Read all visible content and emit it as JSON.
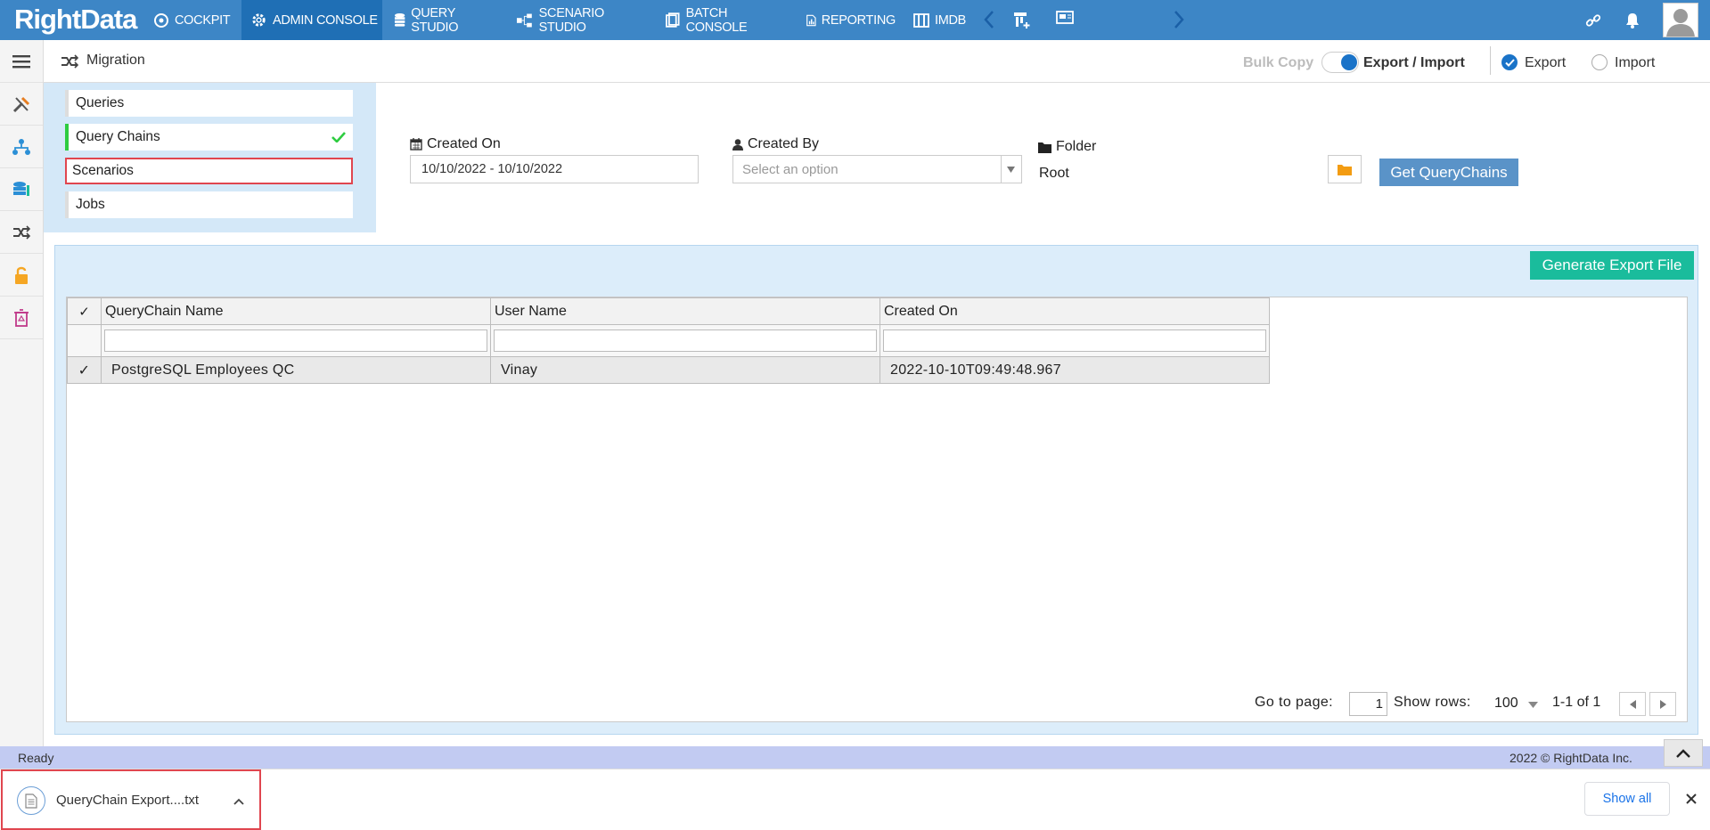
{
  "app": {
    "logo": "RightData"
  },
  "nav": {
    "items": [
      {
        "label": "COCKPIT",
        "icon": "cockpit-icon"
      },
      {
        "label": "ADMIN CONSOLE",
        "icon": "gear-icon"
      },
      {
        "label": "QUERY STUDIO",
        "icon": "database-icon"
      },
      {
        "label": "SCENARIO STUDIO",
        "icon": "scenario-icon"
      },
      {
        "label": "BATCH CONSOLE",
        "icon": "batch-icon"
      },
      {
        "label": "REPORTING",
        "icon": "report-icon"
      },
      {
        "label": "IMDB",
        "icon": "imdb-icon"
      }
    ],
    "active": "ADMIN CONSOLE"
  },
  "header": {
    "title": "Migration",
    "bulk_copy": "Bulk Copy",
    "export_import": "Export / Import",
    "export": "Export",
    "import": "Import"
  },
  "left_menu": {
    "items": [
      "Queries",
      "Query Chains",
      "Scenarios",
      "Jobs"
    ],
    "selected": "Query Chains",
    "highlighted": "Scenarios"
  },
  "filters": {
    "created_on_label": "Created On",
    "created_on_value": "10/10/2022 - 10/10/2022",
    "created_by_label": "Created By",
    "created_by_placeholder": "Select an option",
    "folder_label": "Folder",
    "folder_value": "Root",
    "get_button": "Get QueryChains"
  },
  "grid": {
    "generate_button": "Generate Export File",
    "columns": [
      "QueryChain Name",
      "User Name",
      "Created On"
    ],
    "rows": [
      {
        "name": "PostgreSQL Employees QC",
        "user": "Vinay",
        "created": "2022-10-10T09:49:48.967"
      }
    ],
    "check_mark": "✓",
    "pager": {
      "go_to_page": "Go to page:",
      "page": "1",
      "show_rows": "Show rows:",
      "rows": "100",
      "range": "1-1 of 1"
    }
  },
  "status": {
    "left": "Ready",
    "right": "2022 © RightData Inc."
  },
  "download": {
    "file": "QueryChain Export....txt",
    "show_all": "Show all"
  },
  "colors": {
    "nav": "#3d86c6",
    "nav_active": "#1f6fb5",
    "accent_green": "#1abc9c",
    "button_blue": "#5a93c8",
    "folder_orange": "#f39c12"
  }
}
